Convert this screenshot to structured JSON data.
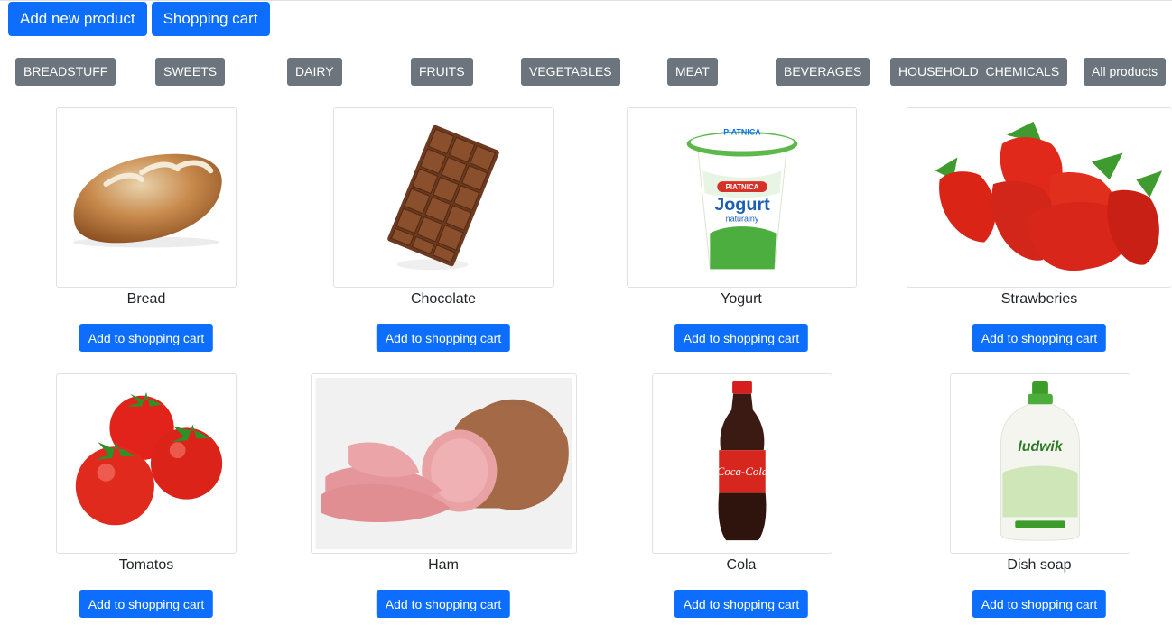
{
  "toolbar": {
    "add_product_label": "Add new product",
    "cart_label": "Shopping cart"
  },
  "categories": [
    "BREADSTUFF",
    "SWEETS",
    "DAIRY",
    "FRUITS",
    "VEGETABLES",
    "MEAT",
    "BEVERAGES",
    "HOUSEHOLD_CHEMICALS",
    "All products"
  ],
  "products": [
    {
      "name": "Bread",
      "button": "Add to shopping cart",
      "image": "bread-image"
    },
    {
      "name": "Chocolate",
      "button": "Add to shopping cart",
      "image": "chocolate-image"
    },
    {
      "name": "Yogurt",
      "button": "Add to shopping cart",
      "image": "yogurt-image"
    },
    {
      "name": "Strawberies",
      "button": "Add to shopping cart",
      "image": "strawberries-image"
    },
    {
      "name": "Tomatos",
      "button": "Add to shopping cart",
      "image": "tomatoes-image"
    },
    {
      "name": "Ham",
      "button": "Add to shopping cart",
      "image": "ham-image"
    },
    {
      "name": "Cola",
      "button": "Add to shopping cart",
      "image": "cola-image"
    },
    {
      "name": "Dish soap",
      "button": "Add to shopping cart",
      "image": "dish-soap-image"
    }
  ],
  "product_images": {
    "yogurt_brand": "PIATNICA",
    "yogurt_title": "Jogurt",
    "yogurt_sub": "naturalny",
    "cola_brand": "Coca-Cola",
    "soap_brand": "ludwik"
  },
  "colors": {
    "primary": "#0d6efd",
    "secondary": "#6c757d"
  }
}
